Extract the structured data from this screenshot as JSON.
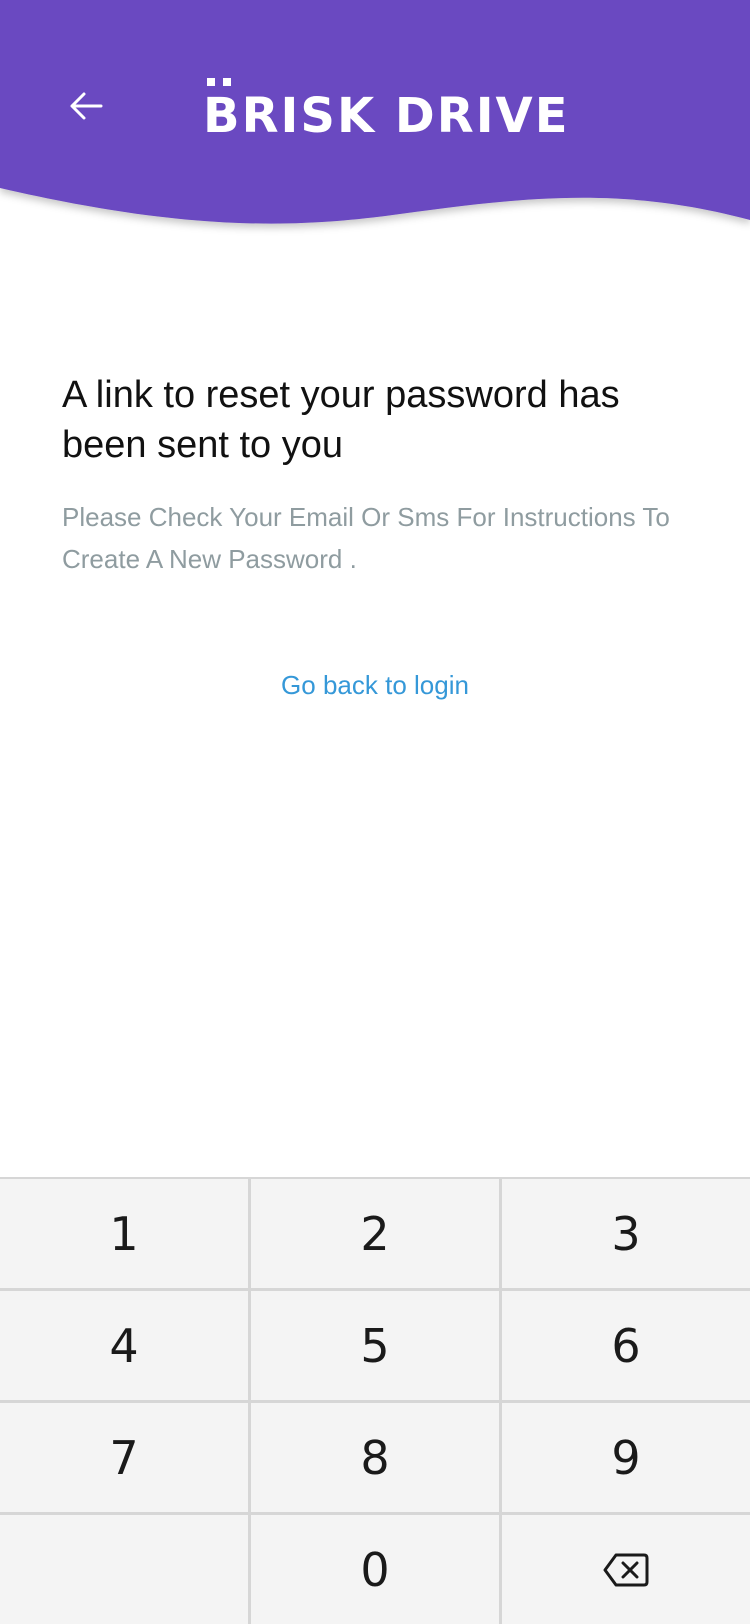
{
  "header": {
    "brand_name": "BRISK DRIVE",
    "back_icon": "arrow-left-icon",
    "brand_color": "#6a48c1"
  },
  "message": {
    "title": "A link to reset your password has been sent to you",
    "subtitle": "Please Check Your Email Or Sms For Instructions To Create A New Password ."
  },
  "actions": {
    "back_to_login": "Go back to login",
    "link_color": "#3598d8"
  },
  "keypad": {
    "keys": [
      "1",
      "2",
      "3",
      "4",
      "5",
      "6",
      "7",
      "8",
      "9",
      "",
      "0"
    ],
    "delete_icon": "backspace-icon"
  }
}
